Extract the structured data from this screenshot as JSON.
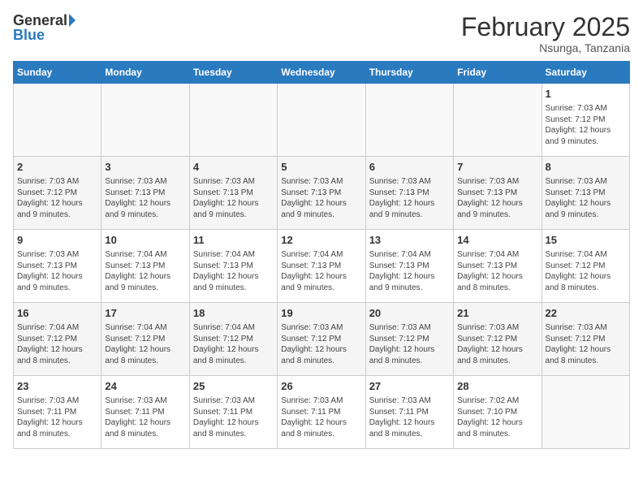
{
  "logo": {
    "general": "General",
    "blue": "Blue"
  },
  "title": {
    "month_year": "February 2025",
    "location": "Nsunga, Tanzania"
  },
  "headers": [
    "Sunday",
    "Monday",
    "Tuesday",
    "Wednesday",
    "Thursday",
    "Friday",
    "Saturday"
  ],
  "weeks": [
    [
      {
        "day": "",
        "info": ""
      },
      {
        "day": "",
        "info": ""
      },
      {
        "day": "",
        "info": ""
      },
      {
        "day": "",
        "info": ""
      },
      {
        "day": "",
        "info": ""
      },
      {
        "day": "",
        "info": ""
      },
      {
        "day": "1",
        "info": "Sunrise: 7:03 AM\nSunset: 7:12 PM\nDaylight: 12 hours\nand 9 minutes."
      }
    ],
    [
      {
        "day": "2",
        "info": "Sunrise: 7:03 AM\nSunset: 7:12 PM\nDaylight: 12 hours\nand 9 minutes."
      },
      {
        "day": "3",
        "info": "Sunrise: 7:03 AM\nSunset: 7:13 PM\nDaylight: 12 hours\nand 9 minutes."
      },
      {
        "day": "4",
        "info": "Sunrise: 7:03 AM\nSunset: 7:13 PM\nDaylight: 12 hours\nand 9 minutes."
      },
      {
        "day": "5",
        "info": "Sunrise: 7:03 AM\nSunset: 7:13 PM\nDaylight: 12 hours\nand 9 minutes."
      },
      {
        "day": "6",
        "info": "Sunrise: 7:03 AM\nSunset: 7:13 PM\nDaylight: 12 hours\nand 9 minutes."
      },
      {
        "day": "7",
        "info": "Sunrise: 7:03 AM\nSunset: 7:13 PM\nDaylight: 12 hours\nand 9 minutes."
      },
      {
        "day": "8",
        "info": "Sunrise: 7:03 AM\nSunset: 7:13 PM\nDaylight: 12 hours\nand 9 minutes."
      }
    ],
    [
      {
        "day": "9",
        "info": "Sunrise: 7:03 AM\nSunset: 7:13 PM\nDaylight: 12 hours\nand 9 minutes."
      },
      {
        "day": "10",
        "info": "Sunrise: 7:04 AM\nSunset: 7:13 PM\nDaylight: 12 hours\nand 9 minutes."
      },
      {
        "day": "11",
        "info": "Sunrise: 7:04 AM\nSunset: 7:13 PM\nDaylight: 12 hours\nand 9 minutes."
      },
      {
        "day": "12",
        "info": "Sunrise: 7:04 AM\nSunset: 7:13 PM\nDaylight: 12 hours\nand 9 minutes."
      },
      {
        "day": "13",
        "info": "Sunrise: 7:04 AM\nSunset: 7:13 PM\nDaylight: 12 hours\nand 9 minutes."
      },
      {
        "day": "14",
        "info": "Sunrise: 7:04 AM\nSunset: 7:13 PM\nDaylight: 12 hours\nand 8 minutes."
      },
      {
        "day": "15",
        "info": "Sunrise: 7:04 AM\nSunset: 7:12 PM\nDaylight: 12 hours\nand 8 minutes."
      }
    ],
    [
      {
        "day": "16",
        "info": "Sunrise: 7:04 AM\nSunset: 7:12 PM\nDaylight: 12 hours\nand 8 minutes."
      },
      {
        "day": "17",
        "info": "Sunrise: 7:04 AM\nSunset: 7:12 PM\nDaylight: 12 hours\nand 8 minutes."
      },
      {
        "day": "18",
        "info": "Sunrise: 7:04 AM\nSunset: 7:12 PM\nDaylight: 12 hours\nand 8 minutes."
      },
      {
        "day": "19",
        "info": "Sunrise: 7:03 AM\nSunset: 7:12 PM\nDaylight: 12 hours\nand 8 minutes."
      },
      {
        "day": "20",
        "info": "Sunrise: 7:03 AM\nSunset: 7:12 PM\nDaylight: 12 hours\nand 8 minutes."
      },
      {
        "day": "21",
        "info": "Sunrise: 7:03 AM\nSunset: 7:12 PM\nDaylight: 12 hours\nand 8 minutes."
      },
      {
        "day": "22",
        "info": "Sunrise: 7:03 AM\nSunset: 7:12 PM\nDaylight: 12 hours\nand 8 minutes."
      }
    ],
    [
      {
        "day": "23",
        "info": "Sunrise: 7:03 AM\nSunset: 7:11 PM\nDaylight: 12 hours\nand 8 minutes."
      },
      {
        "day": "24",
        "info": "Sunrise: 7:03 AM\nSunset: 7:11 PM\nDaylight: 12 hours\nand 8 minutes."
      },
      {
        "day": "25",
        "info": "Sunrise: 7:03 AM\nSunset: 7:11 PM\nDaylight: 12 hours\nand 8 minutes."
      },
      {
        "day": "26",
        "info": "Sunrise: 7:03 AM\nSunset: 7:11 PM\nDaylight: 12 hours\nand 8 minutes."
      },
      {
        "day": "27",
        "info": "Sunrise: 7:03 AM\nSunset: 7:11 PM\nDaylight: 12 hours\nand 8 minutes."
      },
      {
        "day": "28",
        "info": "Sunrise: 7:02 AM\nSunset: 7:10 PM\nDaylight: 12 hours\nand 8 minutes."
      },
      {
        "day": "",
        "info": ""
      }
    ]
  ]
}
